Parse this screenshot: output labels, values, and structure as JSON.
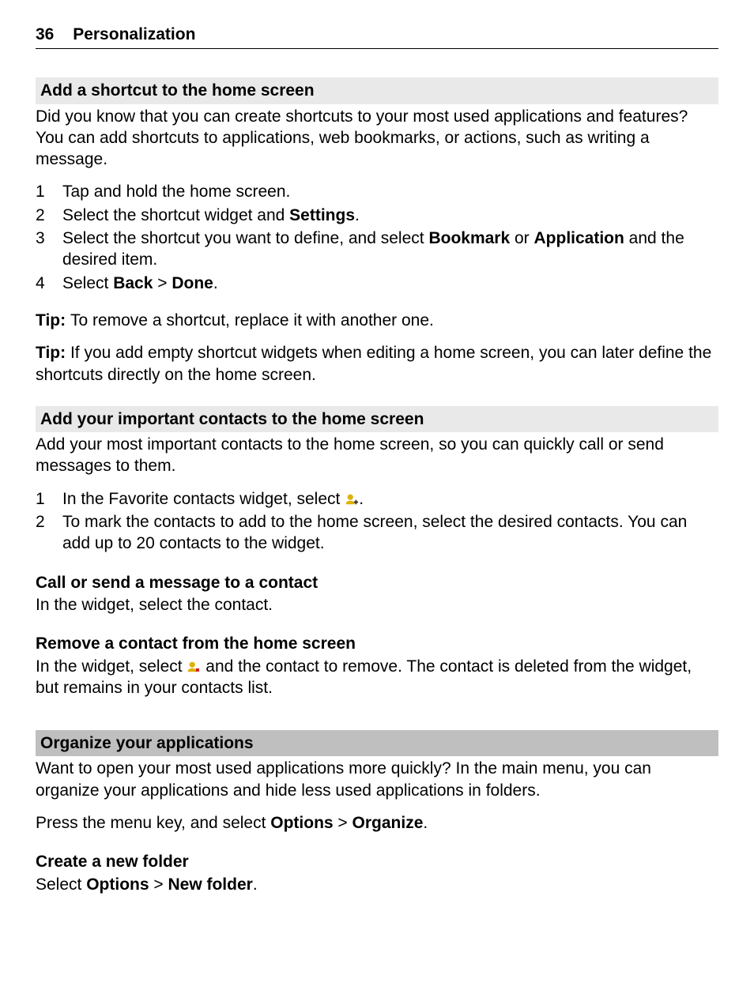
{
  "header": {
    "page_number": "36",
    "title": "Personalization"
  },
  "section1": {
    "title": "Add a shortcut to the home screen",
    "intro": "Did you know that you can create shortcuts to your most used applications and features? You can add shortcuts to applications, web bookmarks, or actions, such as writing a message.",
    "step1": "Tap and hold the home screen.",
    "step2a": "Select the shortcut widget and ",
    "step2b": "Settings",
    "step2c": ".",
    "step3a": "Select the shortcut you want to define, and select ",
    "step3b": "Bookmark",
    "step3c": " or ",
    "step3d": "Application",
    "step3e": " and the desired item.",
    "step4a": "Select ",
    "step4b": "Back",
    "step4c": " > ",
    "step4d": "Done",
    "step4e": ".",
    "tip1_label": "Tip: ",
    "tip1_text": "To remove a shortcut, replace it with another one.",
    "tip2_label": "Tip: ",
    "tip2_text": "If you add empty shortcut widgets when editing a home screen, you can later define the shortcuts directly on the home screen."
  },
  "section2": {
    "title": "Add your important contacts to the home screen",
    "intro": "Add your most important contacts to the home screen, so you can quickly call or send messages to them.",
    "step1a": "In the Favorite contacts widget, select ",
    "step1b": ".",
    "step2": "To mark the contacts to add to the home screen, select the desired contacts. You can add up to 20 contacts to the widget.",
    "subA_title": "Call or send a message to a contact",
    "subA_text": "In the widget, select the contact.",
    "subB_title": "Remove a contact from the home screen",
    "subB_text_a": "In the widget, select ",
    "subB_text_b": " and the contact to remove. The contact is deleted from the widget, but remains in your contacts list."
  },
  "section3": {
    "title": "Organize your applications",
    "intro": "Want to open your most used applications more quickly? In the main menu, you can organize your applications and hide less used applications in folders.",
    "p_a": "Press the menu key, and select ",
    "p_b": "Options",
    "p_c": " > ",
    "p_d": "Organize",
    "p_e": ".",
    "subA_title": "Create a new folder",
    "subA_a": "Select ",
    "subA_b": "Options",
    "subA_c": " > ",
    "subA_d": "New folder",
    "subA_e": "."
  }
}
